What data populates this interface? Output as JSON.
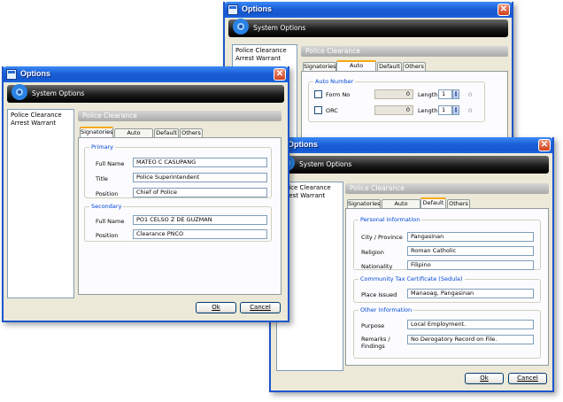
{
  "windows": [
    {
      "title": "Options",
      "banner": "System Options",
      "list_items": [
        "Police Clearance",
        "Arrest Warrant"
      ],
      "section_header": "Police Clearance",
      "tabs": [
        "Signatories",
        "Auto Number",
        "Default",
        "Others"
      ],
      "active_tab": "Auto Number",
      "auto_number": {
        "group_label": "Auto Number",
        "rows": [
          {
            "label": "Form No",
            "value": "0",
            "length_label": "Length",
            "length": "1",
            "preview": "0"
          },
          {
            "label": "ORC",
            "value": "0",
            "length_label": "Length",
            "length": "1",
            "preview": "0"
          }
        ]
      }
    },
    {
      "title": "Options",
      "banner": "System Options",
      "list_items": [
        "Police Clearance",
        "Arrest Warrant"
      ],
      "section_header": "Police Clearance",
      "tabs": [
        "Signatories",
        "Auto Number",
        "Default",
        "Others"
      ],
      "active_tab": "Signatories",
      "primary": {
        "group_label": "Primary",
        "full_name_label": "Full Name",
        "full_name": "MATEO C CASUPANG",
        "title_label": "Title",
        "title": "Police Superintendent",
        "position_label": "Position",
        "position": "Chief of Police"
      },
      "secondary": {
        "group_label": "Secondary",
        "full_name_label": "Full Name",
        "full_name": "PO1 CELSO Z DE GUZMAN",
        "position_label": "Position",
        "position": "Clearance PNCO"
      },
      "ok_label": "Ok",
      "cancel_label": "Cancel"
    },
    {
      "title": "Options",
      "banner": "System Options",
      "list_items": [
        "Police Clearance",
        "Arrest Warrant"
      ],
      "section_header": "Police Clearance",
      "tabs": [
        "Signatories",
        "Auto Number",
        "Default",
        "Others"
      ],
      "active_tab": "Default",
      "personal": {
        "group_label": "Personal Information",
        "city_label": "City / Province",
        "city": "Pangasinan",
        "religion_label": "Religion",
        "religion": "Roman Catholic",
        "nationality_label": "Nationality",
        "nationality": "Filipino"
      },
      "ctc": {
        "group_label": "Community Tax Certificate (Sedula)",
        "place_label": "Place Issued",
        "place": "Manaoag, Pangasinan"
      },
      "other": {
        "group_label": "Other Information",
        "purpose_label": "Purpose",
        "purpose": "Local Employment.",
        "remarks_label": "Remarks /\nFindings",
        "remarks": "No Derogatory Record on File."
      },
      "ok_label": "Ok",
      "cancel_label": "Cancel"
    }
  ]
}
